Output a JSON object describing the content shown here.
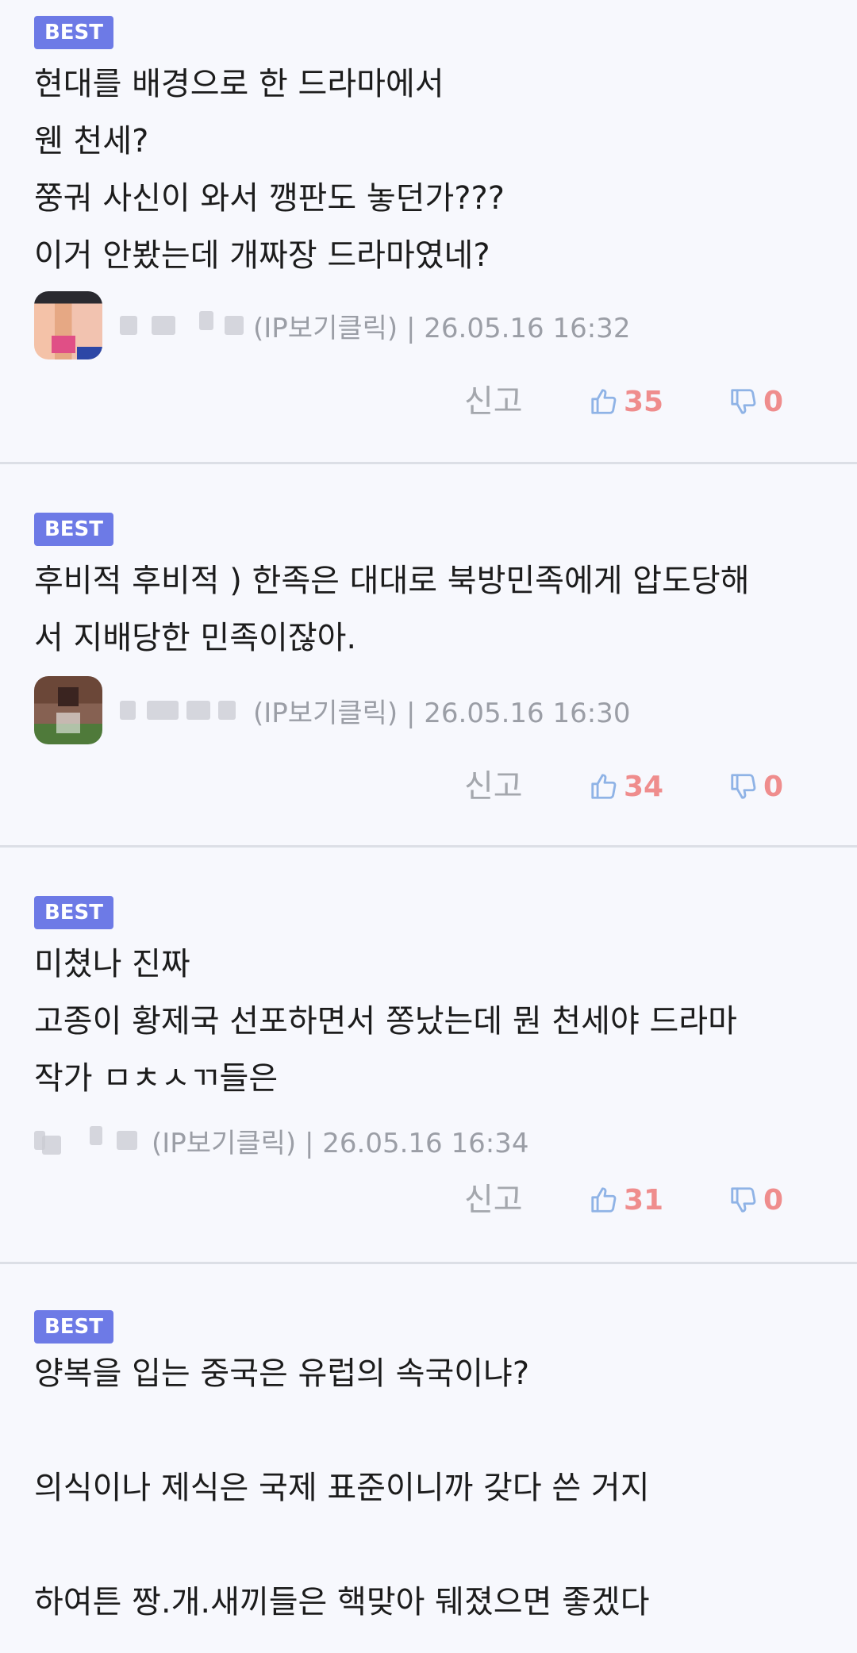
{
  "comments": [
    {
      "badge": "BEST",
      "lines": [
        "현대를 배경으로 한 드라마에서",
        "웬 천세?",
        "쭝궈 사신이 와서 깽판도 놓던가???",
        "이거 안봤는데 개짜장 드라마였네?"
      ],
      "meta": "(IP보기클릭) | 26.05.16 16:32",
      "report_label": "신고",
      "likes": "35",
      "dislikes": "0"
    },
    {
      "badge": "BEST",
      "lines": [
        "후비적 후비적 ) 한족은 대대로 북방민족에게 압도당해",
        "서 지배당한 민족이잖아."
      ],
      "meta": "(IP보기클릭) | 26.05.16 16:30",
      "report_label": "신고",
      "likes": "34",
      "dislikes": "0"
    },
    {
      "badge": "BEST",
      "lines": [
        "미쳤나 진짜",
        "고종이 황제국 선포하면서 쫑났는데 뭔 천세야 드라마",
        "작가 ㅁㅊㅅㄲ들은"
      ],
      "meta": "(IP보기클릭) | 26.05.16 16:34",
      "report_label": "신고",
      "likes": "31",
      "dislikes": "0"
    },
    {
      "badge": "BEST",
      "lines": [
        "양복을 입는 중국은 유럽의 속국이냐?",
        "",
        "의식이나 제식은 국제 표준이니까 갖다 쓴 거지",
        "",
        "하여튼 짱.개.새끼들은 핵맞아 뒈졌으면 좋겠다"
      ]
    }
  ],
  "colors": {
    "background": "#f7f8fd",
    "badge": "#6d7ae6",
    "count": "#ef8d8d",
    "icon": "#8fb3e6",
    "meta": "#9b9ea6"
  },
  "icons": [
    "thumbs-up-icon",
    "thumbs-down-icon"
  ]
}
